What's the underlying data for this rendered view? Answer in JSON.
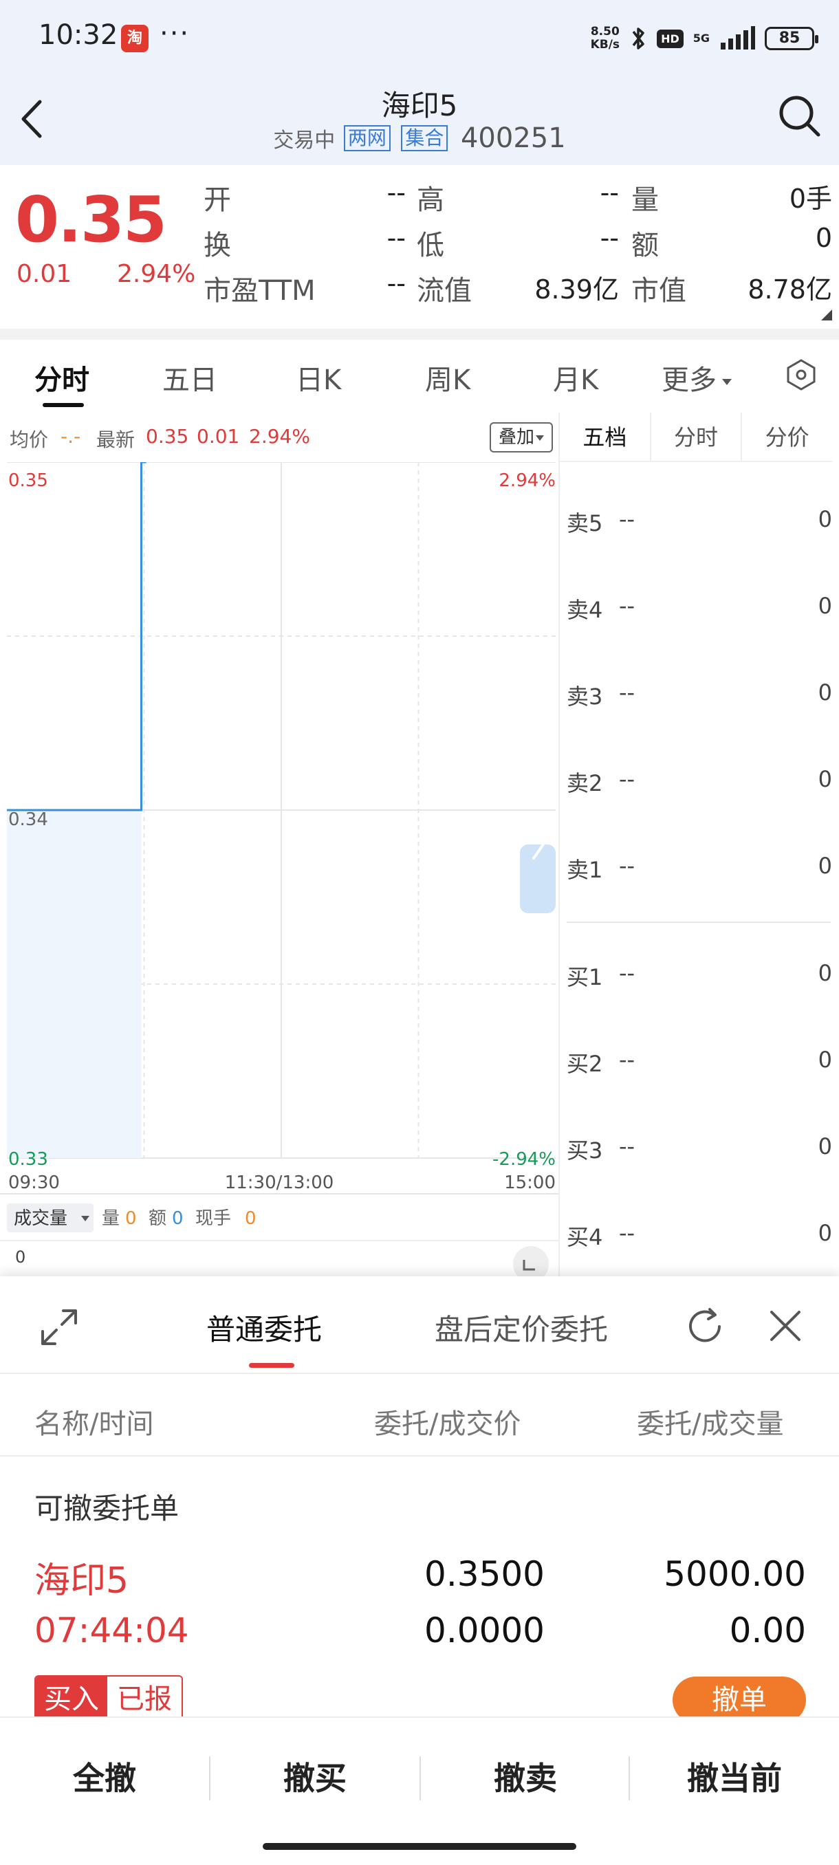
{
  "status_bar": {
    "time": "10:32",
    "app_icon_text": "淘",
    "more": "···",
    "speed_top": "8.50",
    "speed_unit": "KB/s",
    "hd": "HD",
    "signal": "5G",
    "battery": "85"
  },
  "header": {
    "stock_name": "海印5",
    "status": "交易中",
    "tag1": "两网",
    "tag2": "集合",
    "code": "400251"
  },
  "quote": {
    "price": "0.35",
    "change": "0.01",
    "change_pct": "2.94%",
    "fields": [
      {
        "label": "开",
        "value": "--"
      },
      {
        "label": "高",
        "value": "--"
      },
      {
        "label": "量",
        "value": "0手"
      },
      {
        "label": "换",
        "value": "--"
      },
      {
        "label": "低",
        "value": "--"
      },
      {
        "label": "额",
        "value": "0"
      },
      {
        "label": "市盈TTM",
        "value": "--"
      },
      {
        "label": "流值",
        "value": "8.39亿"
      },
      {
        "label": "市值",
        "value": "8.78亿"
      }
    ]
  },
  "chart_tabs": {
    "items": [
      "分时",
      "五日",
      "日K",
      "周K",
      "月K",
      "更多"
    ],
    "active_index": 0
  },
  "chart_header": {
    "avg_label": "均价",
    "avg_value": "-.-",
    "latest_label": "最新",
    "latest_price": "0.35",
    "latest_change": "0.01",
    "latest_pct": "2.94%",
    "overlay_button": "叠加"
  },
  "chart_data": {
    "type": "line",
    "y_top_label": "0.35",
    "y_mid_label": "0.34",
    "y_bottom_label": "0.33",
    "pct_top_label": "2.94%",
    "pct_bottom_label": "-2.94%",
    "x_labels": [
      "09:30",
      "11:30/13:00",
      "15:00"
    ],
    "ylim": [
      0.33,
      0.35
    ],
    "reference_price": 0.34,
    "points": [
      {
        "t": 0.0,
        "price": 0.34
      },
      {
        "t": 0.245,
        "price": 0.34
      },
      {
        "t": 0.245,
        "price": 0.35
      },
      {
        "t": 0.254,
        "price": 0.35
      },
      {
        "t": 0.254,
        "price": 0.352
      }
    ],
    "colors": {
      "line": "#3a8fd8",
      "fill": "#eef5fd",
      "up": "#e03a3a",
      "down": "#1a9a5a"
    }
  },
  "volume": {
    "label": "成交量",
    "vol_label": "量",
    "vol_value": "0",
    "amt_label": "额",
    "amt_value": "0",
    "cur_label": "现手",
    "cur_value": "0",
    "axis_value": "0"
  },
  "order_book": {
    "tabs": [
      "五档",
      "分时",
      "分价"
    ],
    "asks": [
      {
        "label": "卖5",
        "price": "--",
        "vol": "0"
      },
      {
        "label": "卖4",
        "price": "--",
        "vol": "0"
      },
      {
        "label": "卖3",
        "price": "--",
        "vol": "0"
      },
      {
        "label": "卖2",
        "price": "--",
        "vol": "0"
      },
      {
        "label": "卖1",
        "price": "--",
        "vol": "0"
      }
    ],
    "bids": [
      {
        "label": "买1",
        "price": "--",
        "vol": "0"
      },
      {
        "label": "买2",
        "price": "--",
        "vol": "0"
      },
      {
        "label": "买3",
        "price": "--",
        "vol": "0"
      },
      {
        "label": "买4",
        "price": "--",
        "vol": "0"
      }
    ]
  },
  "trade_sheet": {
    "tab_normal": "普通委托",
    "tab_after": "盘后定价委托",
    "col_name": "名称/时间",
    "col_price": "委托/成交价",
    "col_qty": "委托/成交量",
    "section": "可撤委托单",
    "order": {
      "name": "海印5",
      "time": "07:44:04",
      "order_price": "0.3500",
      "deal_price": "0.0000",
      "order_qty": "5000.00",
      "deal_qty": "0.00",
      "side": "买入",
      "status": "已报",
      "cancel": "撤单"
    },
    "actions": [
      "全撤",
      "撤买",
      "撤卖",
      "撤当前"
    ]
  }
}
